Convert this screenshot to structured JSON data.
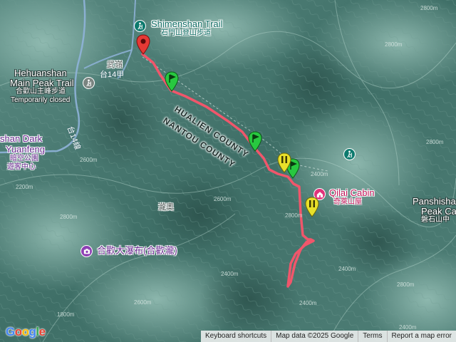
{
  "places": {
    "shimenshan": {
      "name": "Shimenshan Trail",
      "name_zh": "石門山登山步道"
    },
    "hehuanshan": {
      "name_l1": "Hehuanshan",
      "name_l2": "Main Peak Trail",
      "name_zh": "合歡山主峰步道",
      "status": "Temporarily closed"
    },
    "dark_sky": {
      "name_l1": "shan Dark",
      "name_l2": "Yuanfeng",
      "name_zh": "暗空公園",
      "sub": "遊客中心"
    },
    "qilai_cabin": {
      "name": "Qilai Cabin",
      "name_zh": "奇萊山屋"
    },
    "panshishan": {
      "name_l1": "Panshisha",
      "name_l2": "Peak Cam",
      "name_zh": "磐石山中"
    },
    "waterfall": {
      "name": "合歡大瀑布(合歡瀧)"
    },
    "wuling": {
      "name": "武嶺"
    },
    "longao": {
      "name": "瀧奧"
    }
  },
  "roads": {
    "road_14a": "台14甲",
    "road_14": "台14線"
  },
  "counties": {
    "hualien": "HUALIEN COUNTY",
    "nantou": "NANTOU COUNTY"
  },
  "contours": [
    "2800m",
    "2800m",
    "2400m",
    "2600m",
    "2600m",
    "2800m",
    "2400m",
    "2800m",
    "2400m",
    "2800m",
    "2600m",
    "1800m",
    "2800m",
    "2200m",
    "2400m",
    "2400m"
  ],
  "attribution": {
    "logo": "Google",
    "shortcuts": "Keyboard shortcuts",
    "data": "Map data ©2025 Google",
    "terms": "Terms",
    "report": "Report a map error"
  },
  "track": {
    "color": "#f0566b",
    "start_marker_color": "#e53935",
    "waypoint_color_green": "#28c840",
    "waypoint_color_yellow": "#e8e02a"
  },
  "icons": {
    "trail": "hiker-icon",
    "cabin": "cabin-icon",
    "waterfall": "camera-icon",
    "closed_trail": "hiker-icon"
  }
}
